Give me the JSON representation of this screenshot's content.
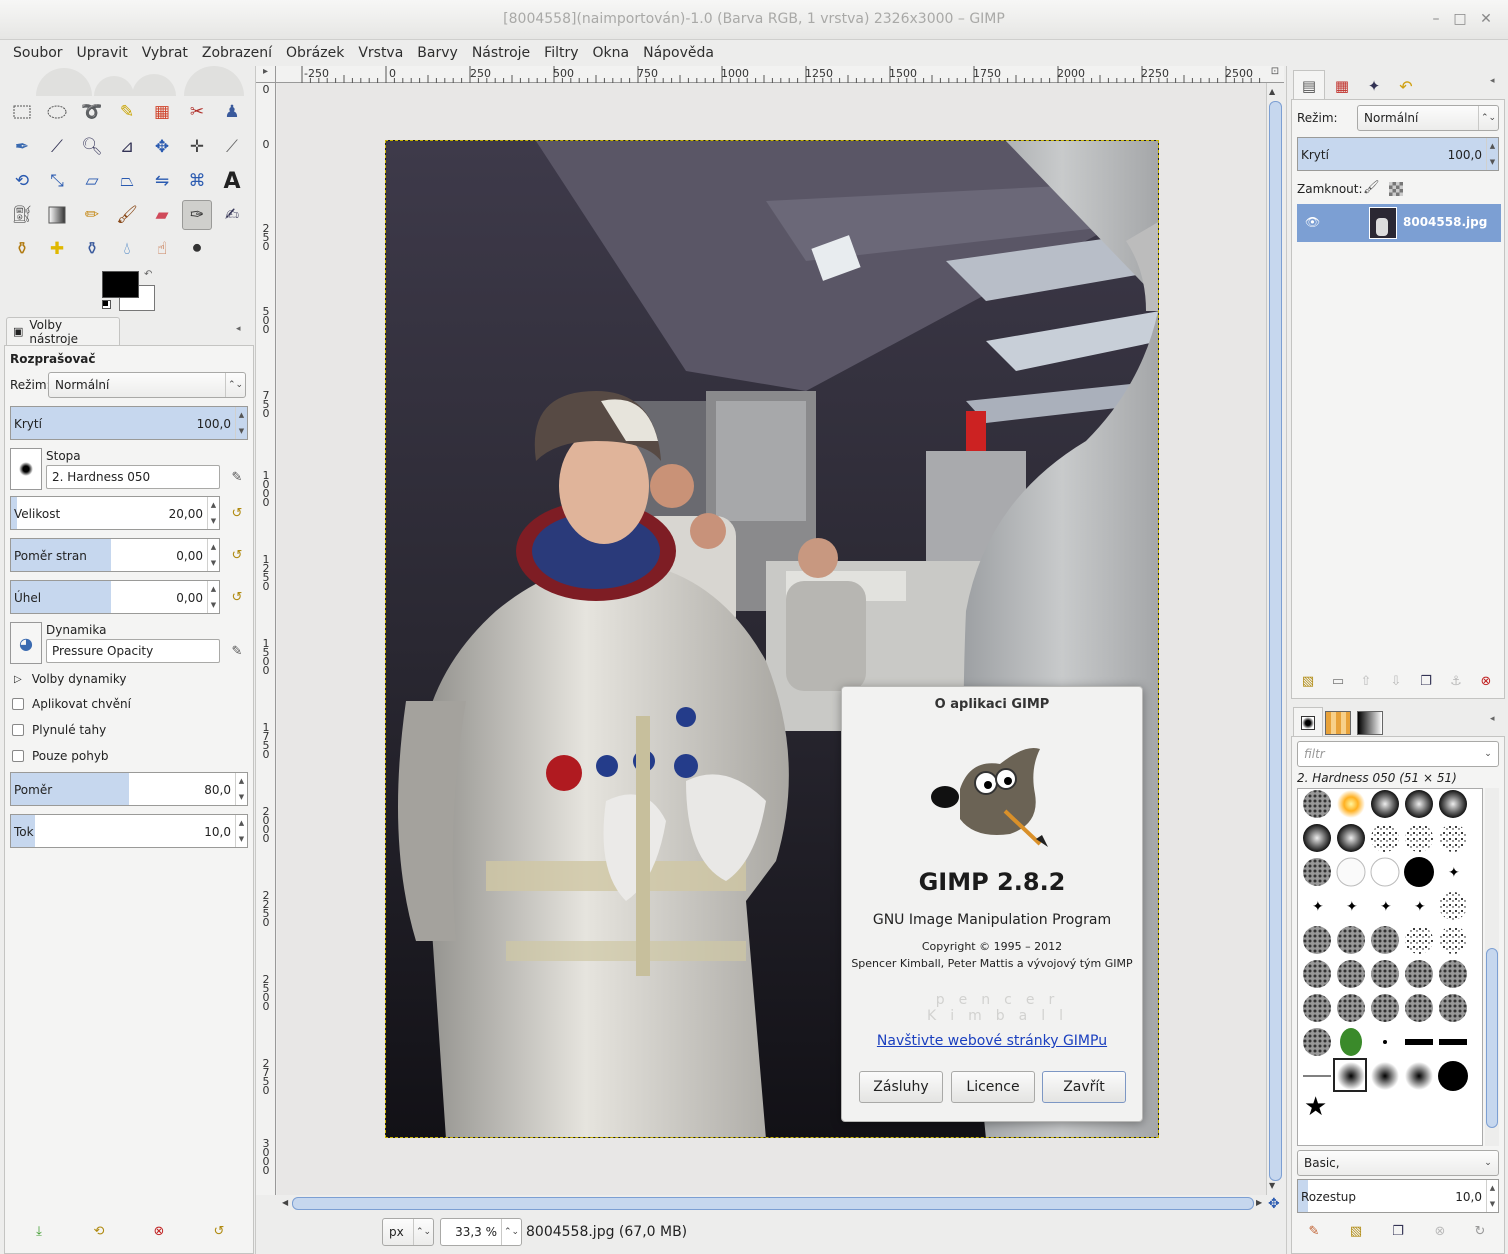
{
  "window": {
    "title": "[8004558](naimportován)-1.0 (Barva RGB, 1 vrstva) 2326x3000 – GIMP"
  },
  "menu": [
    "Soubor",
    "Upravit",
    "Vybrat",
    "Zobrazení",
    "Obrázek",
    "Vrstva",
    "Barvy",
    "Nástroje",
    "Filtry",
    "Okna",
    "Nápověda"
  ],
  "tool_options": {
    "tab_label": "Volby nástroje",
    "tool_name": "Rozprašovač",
    "mode_label": "Režim:",
    "mode_value": "Normální",
    "opacity_label": "Krytí",
    "opacity_value": "100,0",
    "brush_label": "Stopa",
    "brush_value": "2. Hardness 050",
    "size_label": "Velikost",
    "size_value": "20,00",
    "aspect_label": "Poměr stran",
    "aspect_value": "0,00",
    "angle_label": "Úhel",
    "angle_value": "0,00",
    "dynamics_label": "Dynamika",
    "dynamics_value": "Pressure Opacity",
    "dynamics_options": "Volby dynamiky",
    "apply_jitter": "Aplikovat chvění",
    "smooth_stroke": "Plynulé tahy",
    "motion_only": "Pouze pohyb",
    "rate_label": "Poměr",
    "rate_value": "80,0",
    "flow_label": "Tok",
    "flow_value": "10,0"
  },
  "ruler": {
    "top_ticks": [
      "-250",
      "0",
      "250",
      "500",
      "750",
      "1000",
      "1250",
      "1500",
      "1750",
      "2000",
      "2250",
      "2500"
    ],
    "left_ticks": [
      "0",
      "0",
      "250",
      "500",
      "750",
      "1000",
      "1250",
      "1500",
      "1750",
      "2000",
      "2250",
      "2500",
      "2750",
      "3000"
    ]
  },
  "status": {
    "unit": "px",
    "zoom": "33,3 %",
    "file_info": "8004558.jpg (67,0 MB)"
  },
  "about": {
    "title": "O aplikaci GIMP",
    "version": "GIMP 2.8.2",
    "subtitle": "GNU Image Manipulation Program",
    "copyright": "Copyright © 1995 – 2012",
    "authors": "Spencer Kimball, Peter Mattis a vývojový tým GIMP",
    "scroller": "pencer Kimball",
    "link": "Navštivte webové stránky GIMPu",
    "btn_credits": "Zásluhy",
    "btn_license": "Licence",
    "btn_close": "Zavřít"
  },
  "layers": {
    "mode_label": "Režim:",
    "mode_value": "Normální",
    "opacity_label": "Krytí",
    "opacity_value": "100,0",
    "lock_label": "Zamknout:",
    "layer_name": "8004558.jpg"
  },
  "brushes": {
    "filter_placeholder": "filtr",
    "selected": "2. Hardness 050 (51 × 51)",
    "preset": "Basic,",
    "spacing_label": "Rozestup",
    "spacing_value": "10,0"
  },
  "colors": {
    "foreground": "#000000",
    "background": "#ffffff",
    "accent": "#c6d7ee",
    "selected_row": "#7c9fd3",
    "link": "#1a3fbf"
  }
}
